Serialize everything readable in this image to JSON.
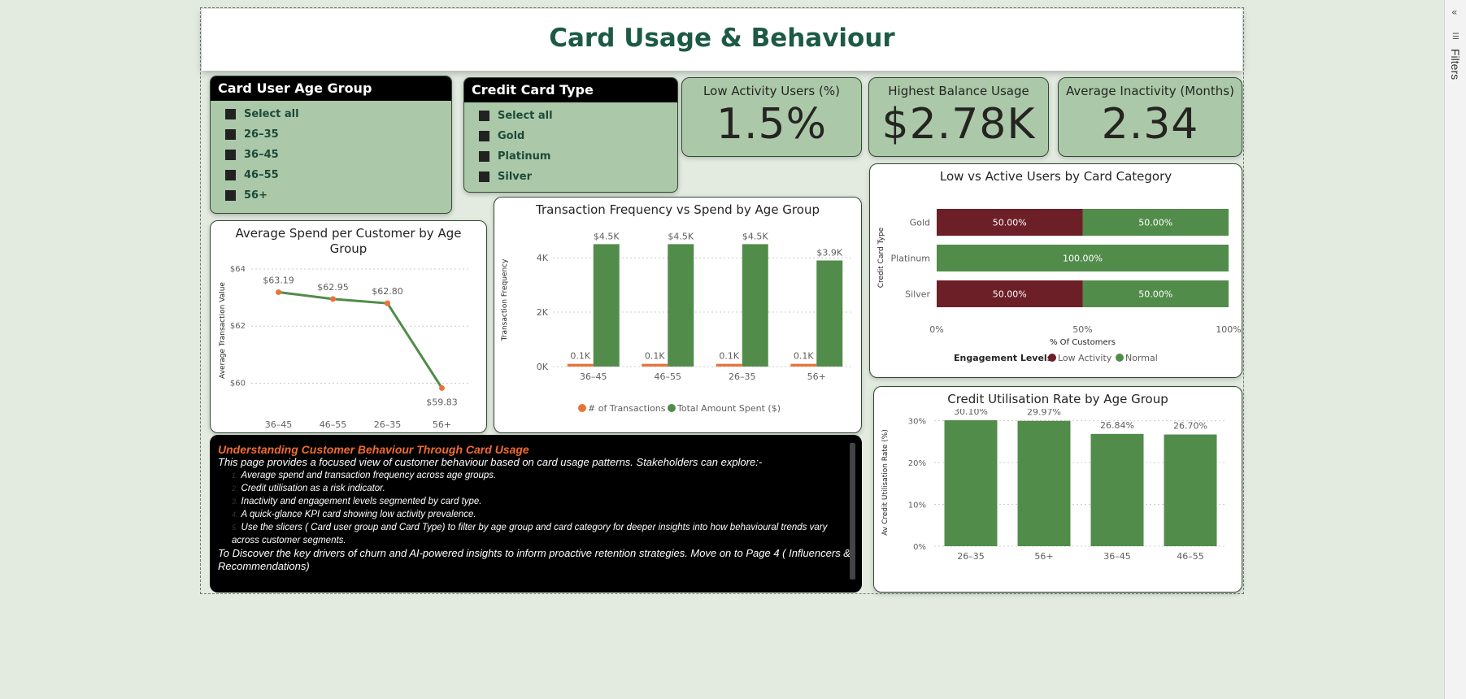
{
  "page_title": "Card Usage & Behaviour",
  "filters_pane": {
    "label": "Filters",
    "collapse": "«"
  },
  "slicer_age": {
    "title": "Card User Age Group",
    "items": [
      "Select all",
      "26–35",
      "36–45",
      "46–55",
      "56+"
    ]
  },
  "slicer_card": {
    "title": "Credit Card Type",
    "items": [
      "Select all",
      "Gold",
      "Platinum",
      "Silver"
    ]
  },
  "cards": {
    "low_activity": {
      "label": "Low Activity Users (%)",
      "value": "1.5%"
    },
    "highest_balance": {
      "label": "Highest Balance Usage",
      "value": "$2.78K"
    },
    "avg_inactivity": {
      "label": "Average Inactivity (Months)",
      "value": "2.34"
    }
  },
  "colors": {
    "green": "#528c4b",
    "orange": "#e8743b",
    "maroon": "#6d1f28",
    "title_green": "#1d5a46",
    "panel_bg": "#abc9a8"
  },
  "text_box": {
    "heading": "Understanding Customer Behaviour Through Card Usage",
    "intro": "This page provides a focused view of customer behaviour based on card usage patterns. Stakeholders can explore:-",
    "items": [
      "Average spend and transaction frequency across age groups.",
      "Credit utilisation as a risk indicator.",
      "Inactivity and engagement levels segmented by card type.",
      "A quick-glance KPI card showing low activity prevalence.",
      "Use the slicers ( Card user group and Card Type) to filter by age group and card category for deeper insights into how behavioural trends vary across customer segments."
    ],
    "item_numbers": [
      "1.",
      "2.",
      "3.",
      "4.",
      "5."
    ],
    "outro": "To Discover the key drivers of churn and AI-powered insights to inform proactive retention strategies. Move on to Page 4 ( Influencers & Recommendations)"
  },
  "chart_data": [
    {
      "id": "avg_spend",
      "type": "line",
      "title": "Average Spend per Customer by Age Group",
      "ylabel": "Average Transaction Value",
      "xlabel": "",
      "categories": [
        "36–45",
        "46–55",
        "26–35",
        "56+"
      ],
      "values": [
        63.19,
        62.95,
        62.8,
        59.83
      ],
      "data_labels": [
        "$63.19",
        "$62.95",
        "$62.80",
        "$59.83"
      ],
      "yticks": [
        60,
        62,
        64
      ],
      "ytick_labels": [
        "$60",
        "$62",
        "$64"
      ],
      "ylim": [
        59.5,
        64.2
      ],
      "grid": true
    },
    {
      "id": "txn_freq",
      "type": "bar",
      "title": "Transaction Frequency vs Spend by Age Group",
      "ylabel": "Transaction Frequency",
      "categories": [
        "36–45",
        "46–55",
        "26–35",
        "56+"
      ],
      "series": [
        {
          "name": "# of Transactions",
          "values": [
            0.1,
            0.1,
            0.1,
            0.1
          ],
          "labels": [
            "0.1K",
            "0.1K",
            "0.1K",
            "0.1K"
          ],
          "color": "#e8743b"
        },
        {
          "name": "Total Amount Spent ($)",
          "values": [
            4.5,
            4.5,
            4.5,
            3.9
          ],
          "labels": [
            "$4.5K",
            "$4.5K",
            "$4.5K",
            "$3.9K"
          ],
          "color": "#528c4b"
        }
      ],
      "yticks": [
        0,
        2,
        4
      ],
      "ytick_labels": [
        "0K",
        "2K",
        "4K"
      ],
      "ylim": [
        0,
        4.9
      ],
      "legend": "bottom",
      "grid": true
    },
    {
      "id": "low_vs_active",
      "type": "bar",
      "orientation": "horizontal-stacked-100",
      "title": "Low vs Active Users by Card Category",
      "ylabel": "Credit Card Type",
      "xlabel": "% Of Customers",
      "categories": [
        "Gold",
        "Platinum",
        "Silver"
      ],
      "series": [
        {
          "name": "Low Activity",
          "values": [
            50,
            0,
            50
          ],
          "color": "#6d1f28"
        },
        {
          "name": "Normal",
          "values": [
            50,
            100,
            50
          ],
          "color": "#528c4b"
        }
      ],
      "segment_labels": [
        [
          "50.00%",
          "50.00%"
        ],
        [
          "",
          "100.00%"
        ],
        [
          "50.00%",
          "50.00%"
        ]
      ],
      "xticks": [
        0,
        50,
        100
      ],
      "xtick_labels": [
        "0%",
        "50%",
        "100%"
      ],
      "legend_title": "Engagement Levels",
      "legend": "bottom"
    },
    {
      "id": "credit_util",
      "type": "bar",
      "title": "Credit Utilisation Rate by Age Group",
      "ylabel": "Av Credit Utilisation Rate (%)",
      "categories": [
        "26–35",
        "56+",
        "36–45",
        "46–55"
      ],
      "values": [
        30.1,
        29.97,
        26.84,
        26.7
      ],
      "data_labels": [
        "30.10%",
        "29.97%",
        "26.84%",
        "26.70%"
      ],
      "yticks": [
        0,
        10,
        20,
        30
      ],
      "ytick_labels": [
        "0%",
        "10%",
        "20%",
        "30%"
      ],
      "ylim": [
        0,
        30.5
      ],
      "grid": true
    }
  ]
}
